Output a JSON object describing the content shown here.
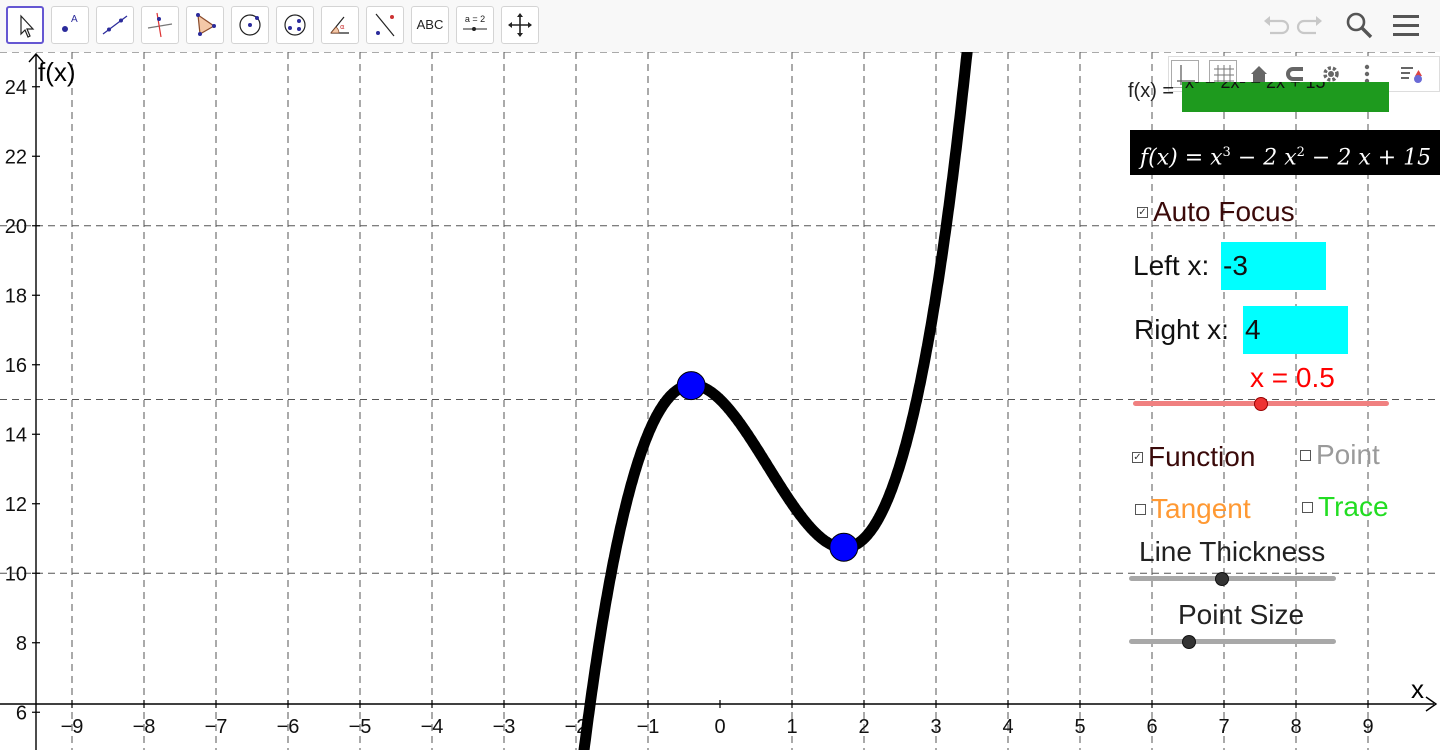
{
  "toolbar": {
    "tools": [
      {
        "name": "move-tool",
        "selected": true
      },
      {
        "name": "point-tool"
      },
      {
        "name": "line-tool"
      },
      {
        "name": "perpendicular-line-tool"
      },
      {
        "name": "polygon-tool"
      },
      {
        "name": "circle-tool"
      },
      {
        "name": "conic-tool"
      },
      {
        "name": "angle-tool"
      },
      {
        "name": "reflect-tool"
      },
      {
        "name": "text-tool",
        "label": "ABC"
      },
      {
        "name": "slider-tool",
        "label": "a = 2"
      },
      {
        "name": "move-graphics-view-tool"
      }
    ],
    "right_icons": [
      "undo-icon",
      "redo-icon",
      "search-icon",
      "menu-icon"
    ]
  },
  "graphics_view_bar": [
    "axes-icon",
    "grid-icon",
    "home-icon",
    "magnet-icon",
    "gear-icon",
    "more-icon",
    "style-bar-icon"
  ],
  "axes": {
    "x_label": "x",
    "y_label": "f(x)",
    "x_ticks": [
      "−9",
      "−8",
      "−7",
      "−6",
      "−5",
      "−4",
      "−3",
      "−2",
      "−1",
      "0",
      "1",
      "2",
      "3",
      "4",
      "5",
      "6",
      "7",
      "8",
      "9"
    ],
    "y_ticks": [
      "6",
      "8",
      "10",
      "12",
      "14",
      "16",
      "18",
      "20",
      "22",
      "24"
    ],
    "xlim": [
      -9.5,
      9.8
    ],
    "ylim": [
      5.7,
      25
    ],
    "grid": true
  },
  "function": {
    "label": "f(x) =",
    "input_text": "x³ − 2x² − 2x + 15",
    "latex_prefix": "f(x) = x",
    "latex_exp": "3",
    "latex_mid": " − 2 x",
    "latex_exp2": "2",
    "latex_suffix": " − 2 x + 15",
    "coefficients": [
      1,
      -2,
      -2,
      15
    ],
    "color": "#000000"
  },
  "points": [
    {
      "x": -0.4,
      "y": 15.4,
      "color": "#0000ff"
    },
    {
      "x": 1.72,
      "y": 10.75,
      "color": "#0000ff"
    }
  ],
  "controls": {
    "auto_focus": {
      "label": "Auto Focus",
      "checked": true
    },
    "left_x": {
      "label": "Left x:",
      "value": "-3"
    },
    "right_x": {
      "label": "Right x:",
      "value": "4"
    },
    "x_slider": {
      "label": "x = 0.5",
      "value": 0.5,
      "color": "#ff0000",
      "track_color": "#f08080",
      "position": 0.5
    },
    "function_check": {
      "label": "Function",
      "checked": true,
      "color": "#3a0a0a"
    },
    "point_check": {
      "label": "Point",
      "checked": false,
      "color": "#9a9a9a"
    },
    "tangent_check": {
      "label": "Tangent",
      "checked": false,
      "color": "#ff9933"
    },
    "trace_check": {
      "label": "Trace",
      "checked": false,
      "color": "#22dd22"
    },
    "line_thickness": {
      "label": "Line Thickness",
      "position": 0.45
    },
    "point_size": {
      "label": "Point Size",
      "position": 0.29
    }
  }
}
